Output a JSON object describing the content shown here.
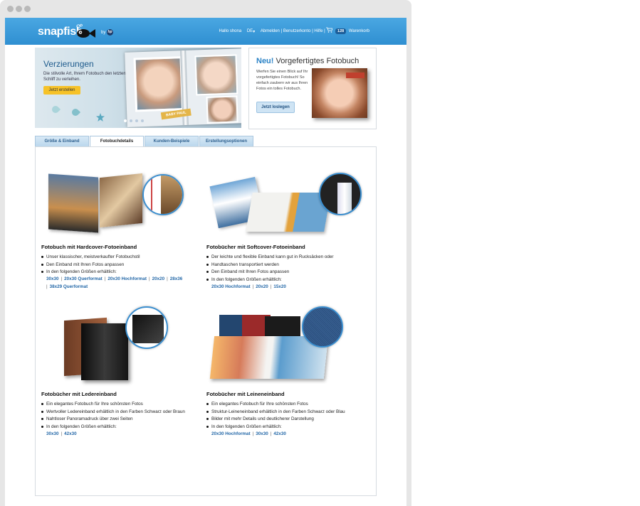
{
  "header": {
    "logo": "snapfish",
    "logo_by": "by",
    "logo_hp": "hp",
    "greeting": "Hallo shona",
    "lang": "DE",
    "lang_caret": "▾",
    "links": [
      "Abmelden",
      "Benutzerkonto",
      "Hilfe"
    ],
    "link_sep": "|",
    "cart_count": "128",
    "cart_label": "Warenkorb"
  },
  "banner_left": {
    "title": "Verzierungen",
    "text": "Die stilvolle Art, Ihrem Fotobuch den letzten Schliff zu verleihen.",
    "button": "Jetzt erstellen",
    "tag": "BABY PAUL"
  },
  "banner_right": {
    "title_new": "Neu!",
    "title_rest": " Vorgefertigtes Fotobuch",
    "text": "Werfen Sie einen Blick auf Ihr vorgefertigtes Fotobuch! So einfach zaubern wir aus Ihren Fotos ein tolles Fotobuch.",
    "button": "Jetzt loslegen"
  },
  "tabs": [
    "Größe & Einband",
    "Fotobuchdetails",
    "Kunden-Beispiele",
    "Erstellungsoptionen"
  ],
  "products": [
    {
      "title": "Fotobuch mit Hardcover-Fotoeinband",
      "bullets": [
        "Unser klassischer, meistverkaufter Fotobuchstil",
        "Den Einband mit Ihren Fotos anpassen",
        "In den folgenden Größen erhältlich:"
      ],
      "sizes_line1": [
        "30x30",
        "20x30 Querformat",
        "20x30 Hochformat",
        "20x20",
        "28x36"
      ],
      "sizes_line2": [
        "38x29 Querformat"
      ]
    },
    {
      "title": "Fotobücher mit Softcover-Fotoeinband",
      "bullets": [
        "Der leichte und flexible Einband kann gut in Rucksäcken oder",
        "Handtaschen transportiert werden",
        "Den Einband mit Ihren Fotos anpassen",
        "In den folgenden Größen erhältlich:"
      ],
      "sizes_line1": [
        "20x30 Hochformat",
        "20x20",
        "15x20"
      ]
    },
    {
      "title": "Fotobücher mit Ledereinband",
      "bullets": [
        "Ein elegantes Fotobuch für Ihre schönsten Fotos",
        "Wertvoller Ledereinband erhältlich in den Farben Schwarz oder Braun",
        "Nahtloser Panoramadruck über zwei Seiten",
        "In den folgenden Größen erhältlich:"
      ],
      "sizes_line1": [
        "30x30",
        "42x30"
      ]
    },
    {
      "title": "Fotobücher mit Leineneinband",
      "bullets": [
        "Ein elegantes Fotobuch für Ihre schönsten Fotos",
        "Struktur-Leineneinband erhältlich in den Farben Schwarz oder Blau",
        "Bilder mit mehr Details und deutlicherer Darstellung",
        "In den folgenden Größen erhältlich:"
      ],
      "sizes_line1": [
        "20x30 Hochformat",
        "30x30",
        "42x30"
      ]
    }
  ],
  "colors": {
    "header_blue": "#3a9bd9",
    "link_blue": "#2468a8",
    "accent_yellow": "#f6c228"
  }
}
